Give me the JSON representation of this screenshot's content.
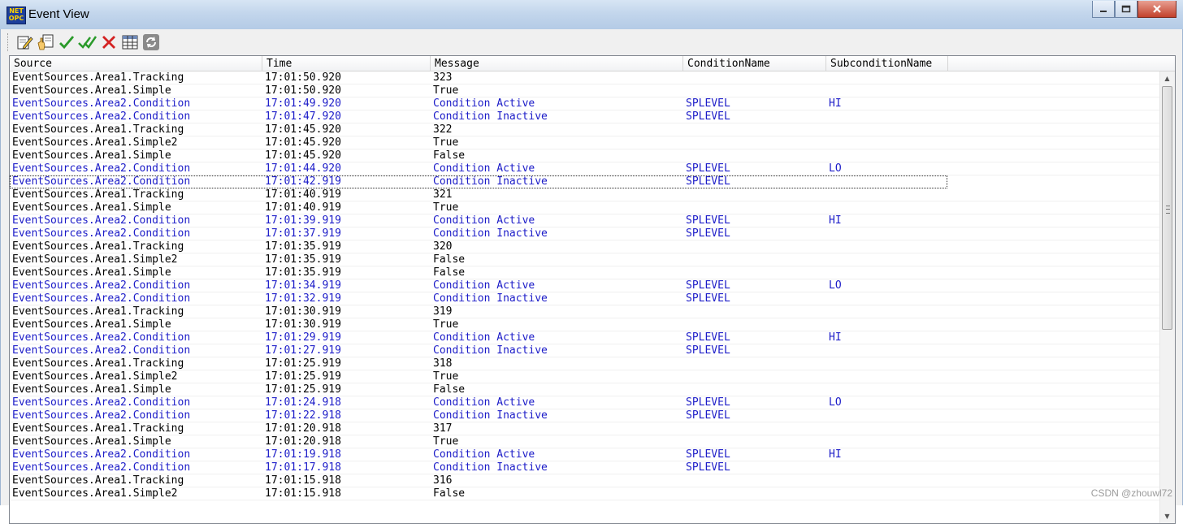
{
  "window": {
    "title": "Event View",
    "logo_top": "NET",
    "logo_bottom": "OPC"
  },
  "window_buttons": [
    "minimize-icon",
    "maximize-icon",
    "close-icon"
  ],
  "toolbar": [
    "edit-icon",
    "hand-icon",
    "check-icon",
    "double-check-icon",
    "delete-icon",
    "table-icon",
    "refresh-icon"
  ],
  "columns": [
    "Source",
    "Time",
    "Message",
    "ConditionName",
    "SubconditionName"
  ],
  "rows": [
    [
      "EventSources.Area1.Tracking",
      "17:01:50.920",
      "323",
      "",
      ""
    ],
    [
      "EventSources.Area1.Simple",
      "17:01:50.920",
      "True",
      "",
      ""
    ],
    [
      "EventSources.Area2.Condition",
      "17:01:49.920",
      "Condition Active",
      "SPLEVEL",
      "HI"
    ],
    [
      "EventSources.Area2.Condition",
      "17:01:47.920",
      "Condition Inactive",
      "SPLEVEL",
      ""
    ],
    [
      "EventSources.Area1.Tracking",
      "17:01:45.920",
      "322",
      "",
      ""
    ],
    [
      "EventSources.Area1.Simple2",
      "17:01:45.920",
      "True",
      "",
      ""
    ],
    [
      "EventSources.Area1.Simple",
      "17:01:45.920",
      "False",
      "",
      ""
    ],
    [
      "EventSources.Area2.Condition",
      "17:01:44.920",
      "Condition Active",
      "SPLEVEL",
      "LO"
    ],
    [
      "EventSources.Area2.Condition",
      "17:01:42.919",
      "Condition Inactive",
      "SPLEVEL",
      ""
    ],
    [
      "EventSources.Area1.Tracking",
      "17:01:40.919",
      "321",
      "",
      ""
    ],
    [
      "EventSources.Area1.Simple",
      "17:01:40.919",
      "True",
      "",
      ""
    ],
    [
      "EventSources.Area2.Condition",
      "17:01:39.919",
      "Condition Active",
      "SPLEVEL",
      "HI"
    ],
    [
      "EventSources.Area2.Condition",
      "17:01:37.919",
      "Condition Inactive",
      "SPLEVEL",
      ""
    ],
    [
      "EventSources.Area1.Tracking",
      "17:01:35.919",
      "320",
      "",
      ""
    ],
    [
      "EventSources.Area1.Simple2",
      "17:01:35.919",
      "False",
      "",
      ""
    ],
    [
      "EventSources.Area1.Simple",
      "17:01:35.919",
      "False",
      "",
      ""
    ],
    [
      "EventSources.Area2.Condition",
      "17:01:34.919",
      "Condition Active",
      "SPLEVEL",
      "LO"
    ],
    [
      "EventSources.Area2.Condition",
      "17:01:32.919",
      "Condition Inactive",
      "SPLEVEL",
      ""
    ],
    [
      "EventSources.Area1.Tracking",
      "17:01:30.919",
      "319",
      "",
      ""
    ],
    [
      "EventSources.Area1.Simple",
      "17:01:30.919",
      "True",
      "",
      ""
    ],
    [
      "EventSources.Area2.Condition",
      "17:01:29.919",
      "Condition Active",
      "SPLEVEL",
      "HI"
    ],
    [
      "EventSources.Area2.Condition",
      "17:01:27.919",
      "Condition Inactive",
      "SPLEVEL",
      ""
    ],
    [
      "EventSources.Area1.Tracking",
      "17:01:25.919",
      "318",
      "",
      ""
    ],
    [
      "EventSources.Area1.Simple2",
      "17:01:25.919",
      "True",
      "",
      ""
    ],
    [
      "EventSources.Area1.Simple",
      "17:01:25.919",
      "False",
      "",
      ""
    ],
    [
      "EventSources.Area2.Condition",
      "17:01:24.918",
      "Condition Active",
      "SPLEVEL",
      "LO"
    ],
    [
      "EventSources.Area2.Condition",
      "17:01:22.918",
      "Condition Inactive",
      "SPLEVEL",
      ""
    ],
    [
      "EventSources.Area1.Tracking",
      "17:01:20.918",
      "317",
      "",
      ""
    ],
    [
      "EventSources.Area1.Simple",
      "17:01:20.918",
      "True",
      "",
      ""
    ],
    [
      "EventSources.Area2.Condition",
      "17:01:19.918",
      "Condition Active",
      "SPLEVEL",
      "HI"
    ],
    [
      "EventSources.Area2.Condition",
      "17:01:17.918",
      "Condition Inactive",
      "SPLEVEL",
      ""
    ],
    [
      "EventSources.Area1.Tracking",
      "17:01:15.918",
      "316",
      "",
      ""
    ],
    [
      "EventSources.Area1.Simple2",
      "17:01:15.918",
      "False",
      "",
      ""
    ]
  ],
  "colors": {
    "condition_text": "#1c1cc8",
    "normal_text": "#000000"
  },
  "watermark": "CSDN @zhouwl72"
}
